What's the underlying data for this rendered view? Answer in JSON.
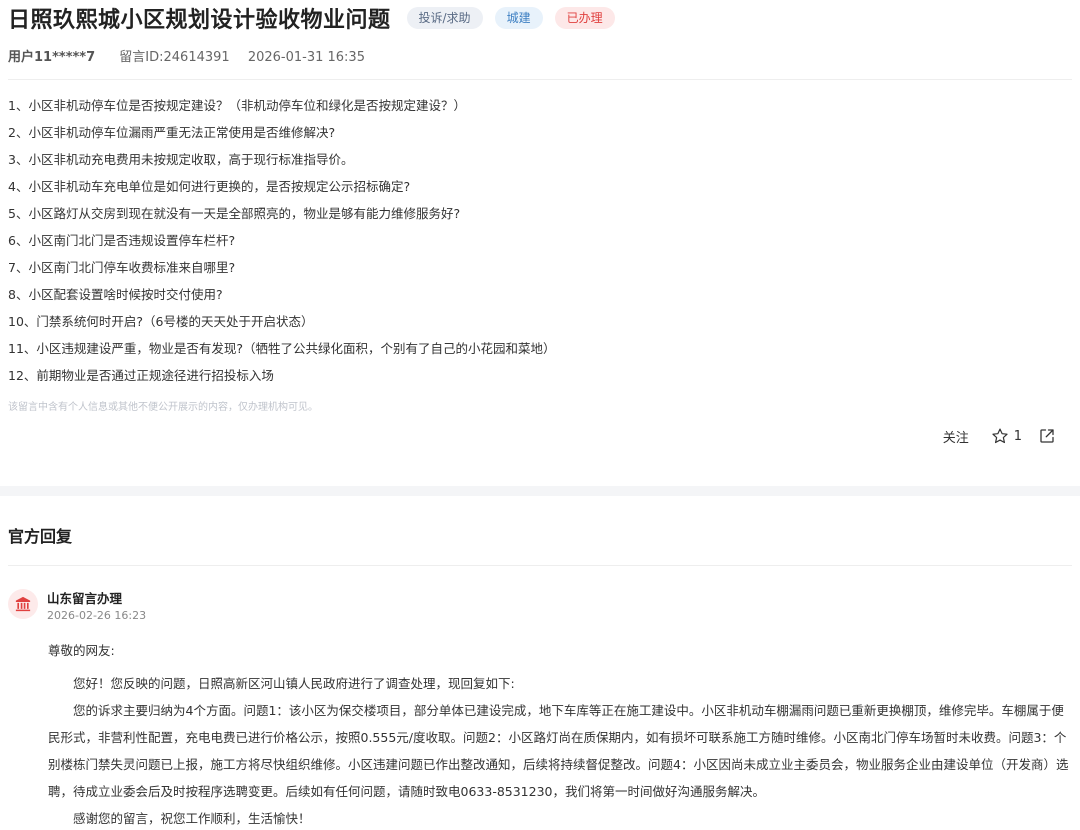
{
  "header": {
    "title": "日照玖熙城小区规划设计验收物业问题",
    "tags": {
      "type": "投诉/求助",
      "category": "城建",
      "status": "已办理"
    },
    "meta": {
      "user": "用户11*****7",
      "message_id": "留言ID:24614391",
      "datetime": "2026-01-31 16:35"
    }
  },
  "questions": [
    "1、小区非机动停车位是否按规定建设？（非机动停车位和绿化是否按规定建设？）",
    "2、小区非机动停车位漏雨严重无法正常使用是否维修解决?",
    "3、小区非机动充电费用未按规定收取，高于现行标准指导价。",
    "4、小区非机动车充电单位是如何进行更换的，是否按规定公示招标确定?",
    "5、小区路灯从交房到现在就没有一天是全部照亮的，物业是够有能力维修服务好?",
    "6、小区南门北门是否违规设置停车栏杆?",
    "7、小区南门北门停车收费标准来自哪里?",
    "8、小区配套设置啥时候按时交付使用?",
    "10、门禁系统何时开启?（6号楼的天天处于开启状态）",
    "11、小区违规建设严重，物业是否有发现?（牺牲了公共绿化面积，个别有了自己的小花园和菜地）",
    "12、前期物业是否通过正规途径进行招投标入场"
  ],
  "privacy_note": "该留言中含有个人信息或其他不便公开展示的内容，仅办理机构可见。",
  "actions": {
    "follow_label": "关注",
    "like_count": "1"
  },
  "reply": {
    "section_title": "官方回复",
    "org_name": "山东留言办理",
    "datetime": "2026-02-26 16:23",
    "greeting": "尊敬的网友:",
    "paragraphs": [
      "您好！您反映的问题，日照高新区河山镇人民政府进行了调查处理，现回复如下:",
      "您的诉求主要归纳为4个方面。问题1：该小区为保交楼项目，部分单体已建设完成，地下车库等正在施工建设中。小区非机动车棚漏雨问题已重新更换棚顶，维修完毕。车棚属于便民形式，非营利性配置，充电电费已进行价格公示，按照0.555元/度收取。问题2：小区路灯尚在质保期内，如有损坏可联系施工方随时维修。小区南北门停车场暂时未收费。问题3：个别楼栋门禁失灵问题已上报，施工方将尽快组织维修。小区违建问题已作出整改通知，后续将持续督促整改。问题4：小区因尚未成立业主委员会，物业服务企业由建设单位（开发商）选聘，待成立业委会后及时按程序选聘变更。后续如有任何问题，请随时致电0633-8531230，我们将第一时间做好沟通服务解决。",
      "感谢您的留言，祝您工作顺利，生活愉快！"
    ]
  },
  "colors": {
    "status_red": "#e0403f",
    "category_blue": "#3d7fc2",
    "type_gray": "#5a6b85",
    "separator": "#f4f5f7"
  },
  "icons": {
    "star": "star-icon",
    "share": "share-icon",
    "org": "government-building-icon"
  }
}
